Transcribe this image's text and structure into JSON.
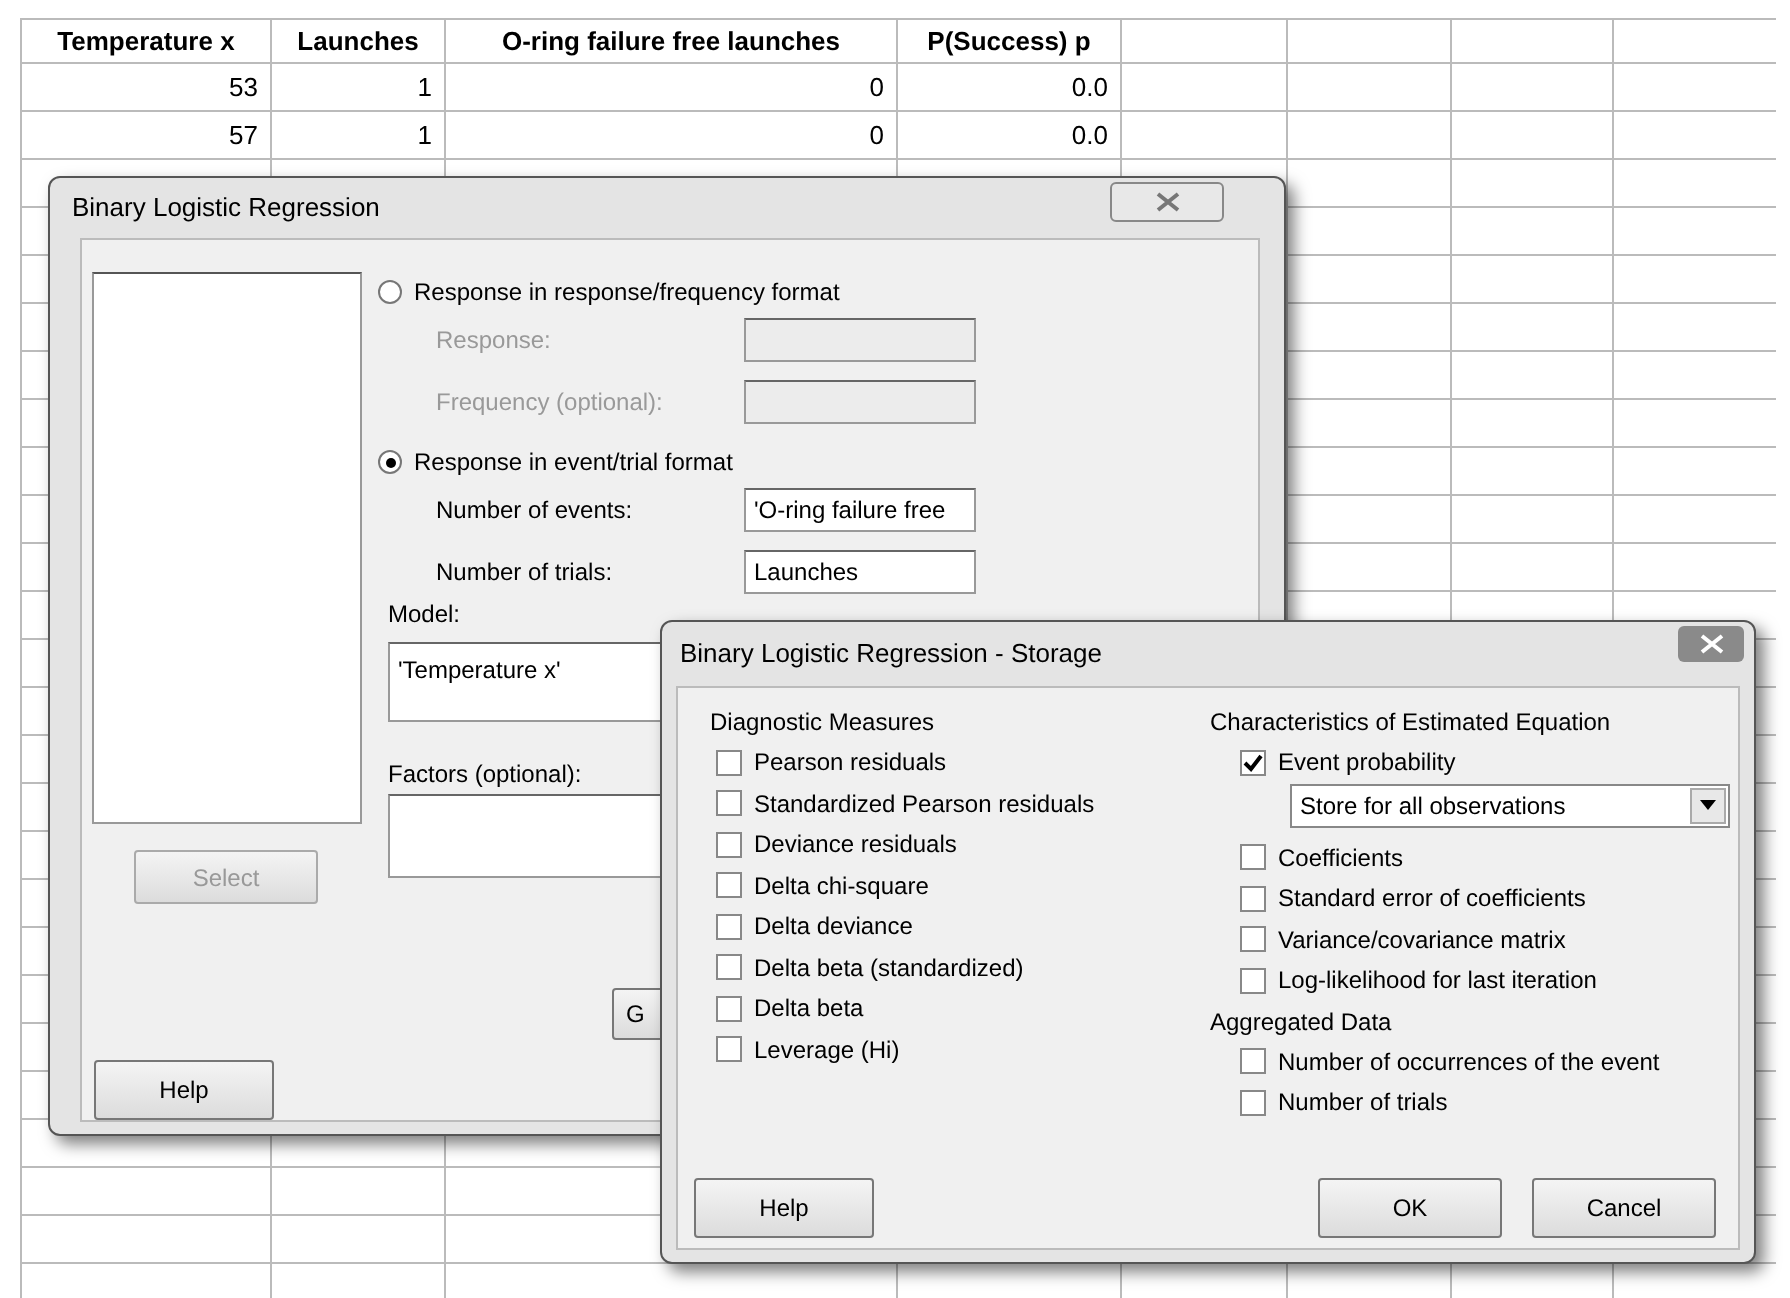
{
  "spreadsheet": {
    "columns": [
      "Temperature x",
      "Launches",
      "O-ring failure free launches",
      "P(Success) p"
    ],
    "rows": [
      [
        "53",
        "1",
        "0",
        "0.0"
      ],
      [
        "57",
        "1",
        "0",
        "0.0"
      ]
    ]
  },
  "dialog": {
    "title": "Binary Logistic Regression",
    "options": [
      {
        "label": "Response in response/frequency format",
        "selected": false,
        "fields": [
          {
            "label": "Response:",
            "disabled": true
          },
          {
            "label": "Frequency (optional):",
            "disabled": true
          }
        ]
      },
      {
        "label": "Response in event/trial format",
        "selected": true,
        "fields": [
          {
            "label": "Number of events:",
            "value": "'O-ring failure free",
            "disabled": false
          },
          {
            "label": "Number of trials:",
            "value": "Launches",
            "disabled": false
          }
        ]
      }
    ],
    "model": {
      "label": "Model:",
      "value": "'Temperature x'"
    },
    "factors": {
      "label": "Factors (optional):"
    },
    "select_button": {
      "label": "Select",
      "disabled": true
    },
    "help_button": "Help",
    "partial_button": "G"
  },
  "storage": {
    "title": "Binary Logistic Regression - Storage",
    "diagnostic": {
      "heading": "Diagnostic Measures",
      "items": [
        {
          "label": "Pearson residuals",
          "checked": false
        },
        {
          "label": "Standardized Pearson residuals",
          "checked": false
        },
        {
          "label": "Deviance residuals",
          "checked": false
        },
        {
          "label": "Delta chi-square",
          "checked": false
        },
        {
          "label": "Delta deviance",
          "checked": false
        },
        {
          "label": "Delta beta (standardized)",
          "checked": false
        },
        {
          "label": "Delta beta",
          "checked": false
        },
        {
          "label": "Leverage (Hi)",
          "checked": false
        }
      ]
    },
    "characteristics": {
      "heading": "Characteristics of Estimated Equation",
      "items": [
        {
          "kind": "checkbox",
          "label": "Event probability",
          "checked": true
        },
        {
          "kind": "dropdown",
          "value": "Store for all observations"
        },
        {
          "kind": "checkbox",
          "label": "Coefficients",
          "checked": false
        },
        {
          "kind": "checkbox",
          "label": "Standard error of coefficients",
          "checked": false
        },
        {
          "kind": "checkbox",
          "label": "Variance/covariance matrix",
          "checked": false
        },
        {
          "kind": "checkbox",
          "label": "Log-likelihood for last iteration",
          "checked": false
        }
      ]
    },
    "aggregated": {
      "heading": "Aggregated Data",
      "items": [
        {
          "label": "Number of occurrences of the event",
          "checked": false
        },
        {
          "label": "Number of trials",
          "checked": false
        }
      ]
    },
    "buttons": [
      "Help",
      "OK",
      "Cancel"
    ]
  }
}
